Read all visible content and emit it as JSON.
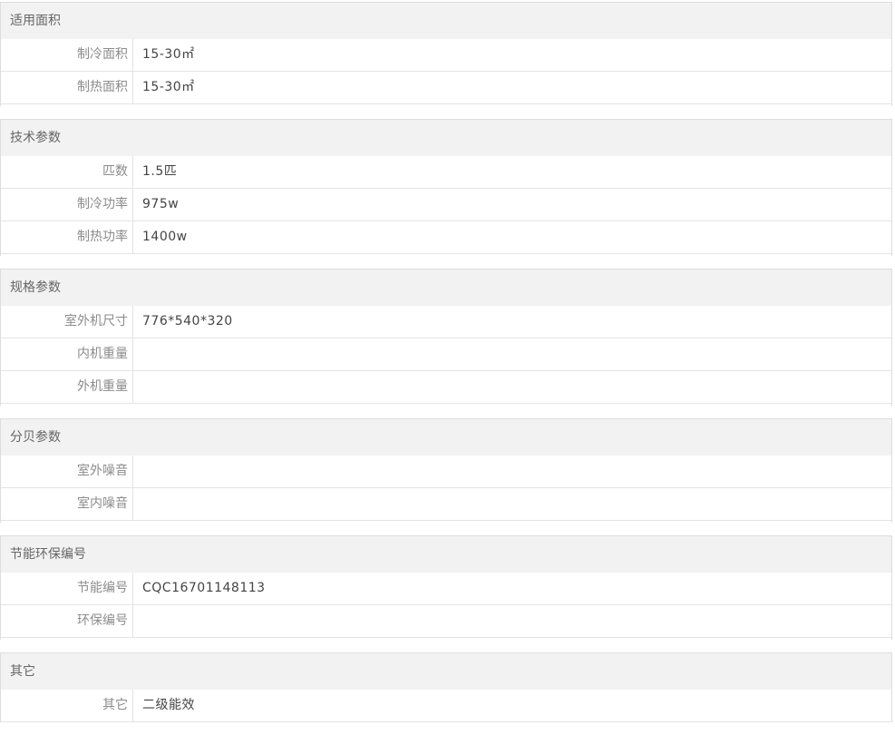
{
  "sections": [
    {
      "title": "适用面积",
      "rows": [
        {
          "label": "制冷面积",
          "value": "15-30㎡"
        },
        {
          "label": "制热面积",
          "value": "15-30㎡"
        }
      ]
    },
    {
      "title": "技术参数",
      "rows": [
        {
          "label": "匹数",
          "value": "1.5匹"
        },
        {
          "label": "制冷功率",
          "value": "975w"
        },
        {
          "label": "制热功率",
          "value": "1400w"
        }
      ]
    },
    {
      "title": "规格参数",
      "rows": [
        {
          "label": "室外机尺寸",
          "value": "776*540*320"
        },
        {
          "label": "内机重量",
          "value": ""
        },
        {
          "label": "外机重量",
          "value": ""
        }
      ]
    },
    {
      "title": "分贝参数",
      "rows": [
        {
          "label": "室外噪音",
          "value": ""
        },
        {
          "label": "室内噪音",
          "value": ""
        }
      ]
    },
    {
      "title": "节能环保编号",
      "rows": [
        {
          "label": "节能编号",
          "value": "CQC16701148113"
        },
        {
          "label": "环保编号",
          "value": ""
        }
      ]
    },
    {
      "title": "其它",
      "rows": [
        {
          "label": "其它",
          "value": "二级能效"
        }
      ]
    }
  ]
}
